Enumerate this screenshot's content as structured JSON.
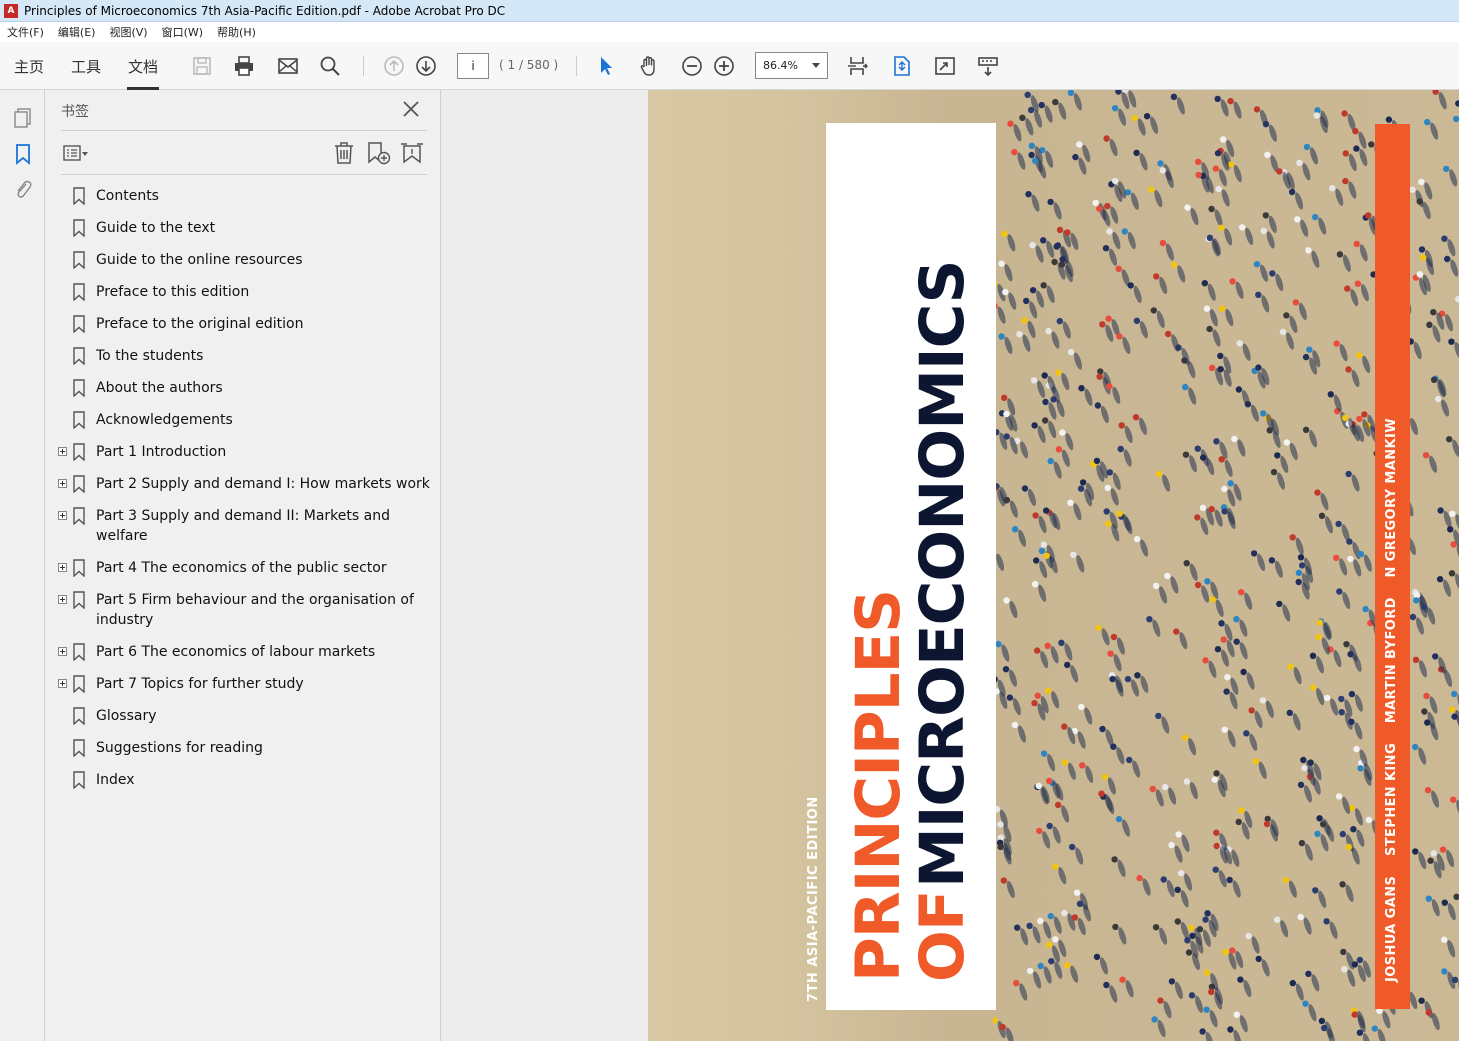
{
  "window": {
    "title": "Principles of Microeconomics 7th Asia-Pacific Edition.pdf - Adobe Acrobat Pro DC"
  },
  "menu": [
    "文件(F)",
    "编辑(E)",
    "视图(V)",
    "窗口(W)",
    "帮助(H)"
  ],
  "tabs": [
    {
      "label": "主页",
      "active": false
    },
    {
      "label": "工具",
      "active": false
    },
    {
      "label": "文档",
      "active": true
    }
  ],
  "toolbar": {
    "page_value": "i",
    "page_count": "( 1 / 580 )",
    "zoom": "86.4%"
  },
  "panel": {
    "title": "书签",
    "bookmarks": [
      {
        "label": "Contents",
        "expandable": false
      },
      {
        "label": "Guide to the text",
        "expandable": false
      },
      {
        "label": "Guide to the online resources",
        "expandable": false
      },
      {
        "label": "Preface to this edition",
        "expandable": false
      },
      {
        "label": "Preface to the original edition",
        "expandable": false
      },
      {
        "label": "To the students",
        "expandable": false
      },
      {
        "label": "About the authors",
        "expandable": false
      },
      {
        "label": "Acknowledgements",
        "expandable": false
      },
      {
        "label": "Part 1 Introduction",
        "expandable": true
      },
      {
        "label": "Part 2 Supply and demand I: How markets work",
        "expandable": true
      },
      {
        "label": "Part 3 Supply and demand II: Markets and welfare",
        "expandable": true
      },
      {
        "label": "Part 4 The economics of the public sector",
        "expandable": true
      },
      {
        "label": "Part 5 Firm behaviour and the organisation of industry",
        "expandable": true
      },
      {
        "label": "Part 6 The economics of labour markets",
        "expandable": true
      },
      {
        "label": "Part 7 Topics for further study",
        "expandable": true
      },
      {
        "label": "Glossary",
        "expandable": false
      },
      {
        "label": "Suggestions for reading",
        "expandable": false
      },
      {
        "label": "Index",
        "expandable": false
      }
    ]
  },
  "cover": {
    "edition": "7TH ASIA-PACIFIC EDITION",
    "title_line1": "PRINCIPLES",
    "title_of": "OF",
    "title_line2": "MICROECONOMICS",
    "authors": "JOSHUA GANS    STEPHEN KING    MARTIN BYFORD    N GREGORY MANKIW",
    "colors": {
      "orange": "#f05a28",
      "navy": "#0d1630"
    }
  }
}
